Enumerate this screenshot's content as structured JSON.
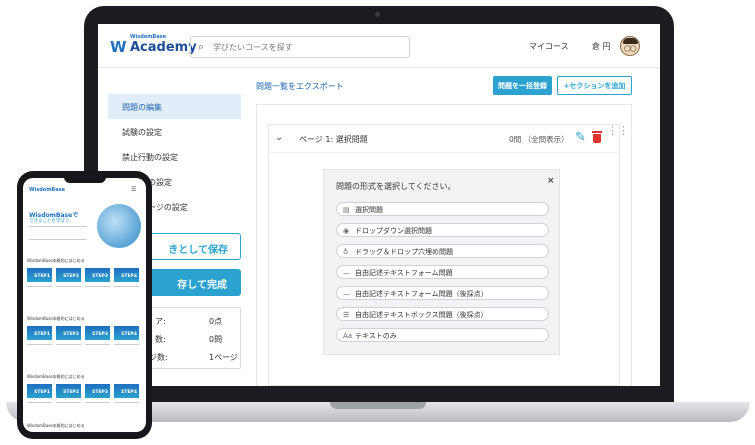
{
  "header": {
    "logo_small": "WisdomBase",
    "logo_big": "Academy",
    "search_placeholder": "学びたいコースを探す",
    "my_course": "マイコース",
    "user_name": "倉 円"
  },
  "sidebar": {
    "items": [
      {
        "label": "問題の編集",
        "active": true
      },
      {
        "label": "試験の設定",
        "active": false
      },
      {
        "label": "禁止行動の設定",
        "active": false
      },
      {
        "label": "の設定",
        "active": false
      },
      {
        "label": "ージの設定",
        "active": false
      }
    ],
    "draft_button": "きとして保存",
    "complete_button": "存して完成",
    "summary": [
      {
        "label": "ア:",
        "value": "0点"
      },
      {
        "label": "数:",
        "value": "0問"
      },
      {
        "label": "ジ数:",
        "value": "1ページ"
      }
    ]
  },
  "main": {
    "export_link": "問題一覧をエクスポート",
    "bulk_button": "問題を一括登録",
    "add_section_button": "+セクションを追加",
    "page": {
      "title": "ページ 1: 選択問題",
      "count": "0問 （全問表示）"
    }
  },
  "modal": {
    "title": "問題の形式を選択してください。",
    "close": "×",
    "options": [
      {
        "icon": "▤",
        "label": "選択問題"
      },
      {
        "icon": "◉",
        "label": "ドロップダウン選択問題"
      },
      {
        "icon": "♁",
        "label": "ドラッグ＆ドロップ穴埋め問題"
      },
      {
        "icon": "—",
        "label": "自由記述テキストフォーム問題"
      },
      {
        "icon": "—",
        "label": "自由記述テキストフォーム問題（後採点）"
      },
      {
        "icon": "☰",
        "label": "自由記述テキストボックス問題（後採点）"
      },
      {
        "icon": "Aa",
        "label": "テキストのみ"
      }
    ]
  },
  "phone": {
    "logo": "WisdomBase",
    "hero_title": "WisdomBaseで",
    "hero_sub": "できることを学ぼう",
    "sections": [
      "WisdomBase本格的にはじめる",
      "WisdomBase本格的にはじめる",
      "WisdomBase本格的にはじめる",
      "WisdomBase本格的にはじめる"
    ],
    "steps": [
      "STEP1",
      "STEP2",
      "STEP3",
      "STEP4"
    ]
  },
  "colors": {
    "accent": "#2ba2cf",
    "brand": "#1f6fbf",
    "danger": "#e0332e",
    "active_bg": "#e1edf8"
  }
}
